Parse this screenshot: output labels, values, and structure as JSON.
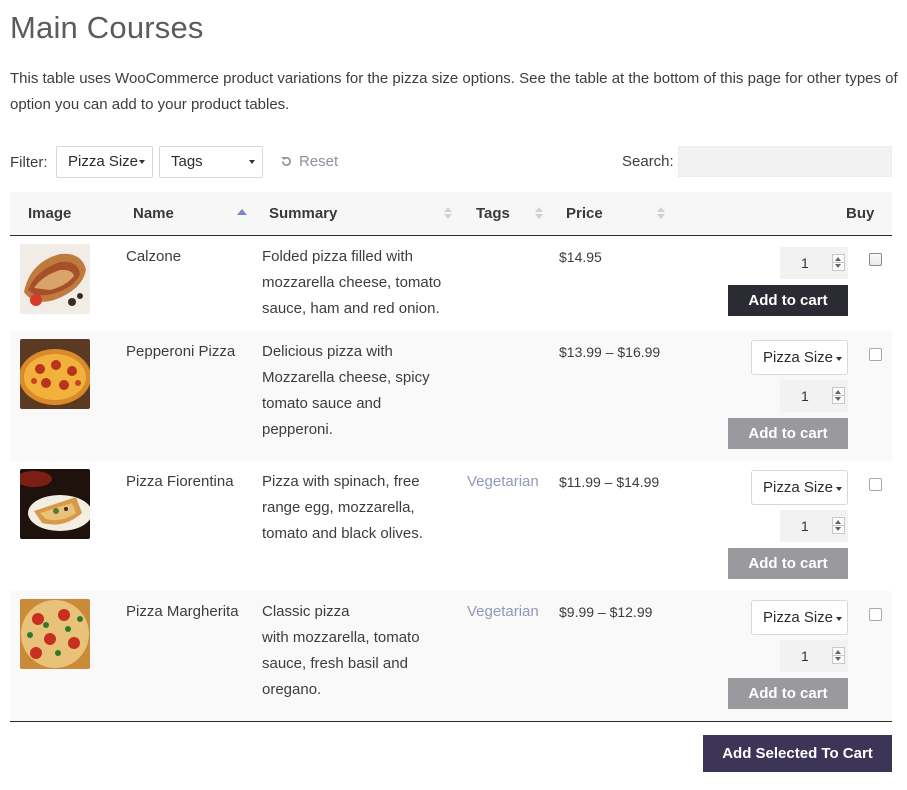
{
  "page": {
    "title": "Main Courses",
    "intro": "This table uses WooCommerce product variations for the pizza size options. See the table at the bottom of this page for other types of option you can add to your product tables."
  },
  "filters": {
    "label": "Filter:",
    "size_select": "Pizza Size",
    "tags_select": "Tags",
    "reset": "Reset",
    "search_label": "Search:",
    "search_value": ""
  },
  "table": {
    "headers": {
      "image": "Image",
      "name": "Name",
      "summary": "Summary",
      "tags": "Tags",
      "price": "Price",
      "buy": "Buy"
    },
    "rows": [
      {
        "name": "Calzone",
        "summary": [
          "Folded pizza filled with",
          "mozzarella cheese, tomato",
          "sauce, ham and red onion."
        ],
        "tags": "",
        "price": "$14.95",
        "qty": "1",
        "variation": "",
        "button": "Add to cart"
      },
      {
        "name": "Pepperoni Pizza",
        "summary": [
          "Delicious pizza with",
          "Mozzarella cheese, spicy",
          "tomato sauce and",
          "pepperoni."
        ],
        "tags": "",
        "price": "$13.99 – $16.99",
        "qty": "1",
        "variation": "Pizza Size",
        "button": "Add to cart"
      },
      {
        "name": "Pizza Fiorentina",
        "summary": [
          "Pizza with spinach, free",
          "range egg, mozzarella,",
          "tomato and black olives."
        ],
        "tags": "Vegetarian",
        "price": "$11.99 – $14.99",
        "qty": "1",
        "variation": "Pizza Size",
        "button": "Add to cart"
      },
      {
        "name": "Pizza Margherita",
        "summary": [
          "Classic pizza",
          "with mozzarella, tomato",
          "sauce, fresh basil and",
          "oregano."
        ],
        "tags": "Vegetarian",
        "price": "$9.99 – $12.99",
        "qty": "1",
        "variation": "Pizza Size",
        "button": "Add to cart"
      }
    ]
  },
  "footer": {
    "add_selected": "Add Selected To Cart"
  },
  "colors": {
    "accent_purple": "#3d3558",
    "dark_button": "#2b2b33",
    "disabled_button": "#9a9a9e",
    "tag_link": "#9298b8",
    "sort_active": "#7c86c6"
  },
  "icons": {
    "reset": "reset-icon",
    "sort": "sort-arrows-icon",
    "dropdown": "chevron-down-icon",
    "spinner": "number-spinner-icon"
  }
}
